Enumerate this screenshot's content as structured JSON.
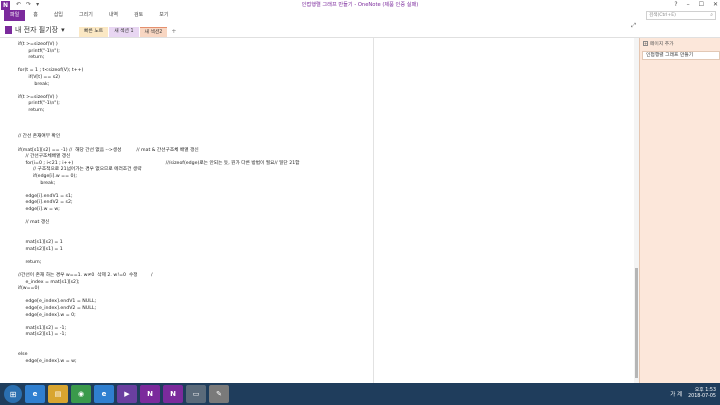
{
  "window": {
    "title": "인접행렬 그래프 만들기 - OneNote (제품 인증 실패)",
    "app_icon": "N",
    "qat": [
      "↶",
      "↷",
      "▾"
    ],
    "controls": [
      "?",
      "–",
      "☐",
      "✕"
    ]
  },
  "ribbon": {
    "tabs": [
      "파일",
      "홈",
      "삽입",
      "그리기",
      "내역",
      "검토",
      "보기"
    ],
    "search_placeholder": "검색(Ctrl+E)",
    "search_icon": "⌕"
  },
  "notebook": {
    "name": "내 전자 필기장",
    "dropdown": "▾",
    "sections": [
      "빠른 노트",
      "새 섹션 1",
      "새 섹션2"
    ],
    "add_section": "+",
    "expand_icon": "⤢"
  },
  "pages": {
    "add_label": "페이지 추가",
    "items": [
      "인접행렬 그래프 만들기"
    ]
  },
  "code": [
    "if(t >=sizeof(V) )",
    "       printf(\"-1\\n\");",
    "       return;",
    "",
    "for(t = 1 ; t<sizeof(V); t++)",
    "       if(V[t] == s2)",
    "           break;",
    "",
    "if(t >=sizeof(V) )",
    "       printf(\"-1\\n\");",
    "       return;",
    "",
    "",
    "",
    "// 간선 존재여부 확인",
    "",
    "if(mat[s1][s2] == -1) //  해당 간선 없음 -->생성          // mat & 간선구조체 배열 갱신",
    "     // 간선구조체배열 갱신",
    "     for(i=0 ; i<21 ; i++)                                                              ///sizeof(edge)로는 안되는 듯, 뭔가 다른 방법이 필요// 일단 21함",
    "          // 구조적으로 21넘어가는 경우 없으므로 에러조건 생략",
    "          if(edge[i].w == 0);",
    "               break;",
    "",
    "     edge[i].endV1 = s1;",
    "     edge[i].endV2 = s2;",
    "     edge[i].w = w;",
    "",
    "     // mat 갱신",
    "",
    "",
    "     mat[s1][s2] = 1",
    "     mat[s2][s1] = 1",
    "",
    "     return;",
    "",
    "//간선이 존재 하는 경우 w==1. w≠0  삭제 2. w!=0  수정         /",
    "     e_index = mat[s1][s2];",
    "if(w==0)",
    "",
    "     edge[e_index].endV1 = NULL;",
    "     edge[e_index].endV2 = NULL;",
    "     edge[e_index].w = 0;",
    "",
    "     mat[s1][s2] = -1;",
    "     mat[s2][s1] = -1;",
    "",
    "",
    "else",
    "     edge[e_index].w = w;"
  ],
  "taskbar": {
    "start_icon": "⊞",
    "apps": [
      {
        "name": "ie",
        "glyph": "e",
        "color": "#2f7fd0"
      },
      {
        "name": "explorer",
        "glyph": "▤",
        "color": "#d8a530"
      },
      {
        "name": "chrome",
        "glyph": "◉",
        "color": "#3a9a4b"
      },
      {
        "name": "ie2",
        "glyph": "e",
        "color": "#2f7fd0"
      },
      {
        "name": "vs",
        "glyph": "▶",
        "color": "#6a3fa0"
      },
      {
        "name": "onenote",
        "glyph": "N",
        "color": "#7b2a9c"
      },
      {
        "name": "onenote2",
        "glyph": "N",
        "color": "#7b2a9c"
      },
      {
        "name": "files",
        "glyph": "▭",
        "color": "#5a6a7a"
      },
      {
        "name": "paint",
        "glyph": "✎",
        "color": "#7a7a7a"
      }
    ],
    "ime": "가",
    "tray_text": "가 계",
    "time": "오후 1:53",
    "date": "2018-07-05"
  }
}
